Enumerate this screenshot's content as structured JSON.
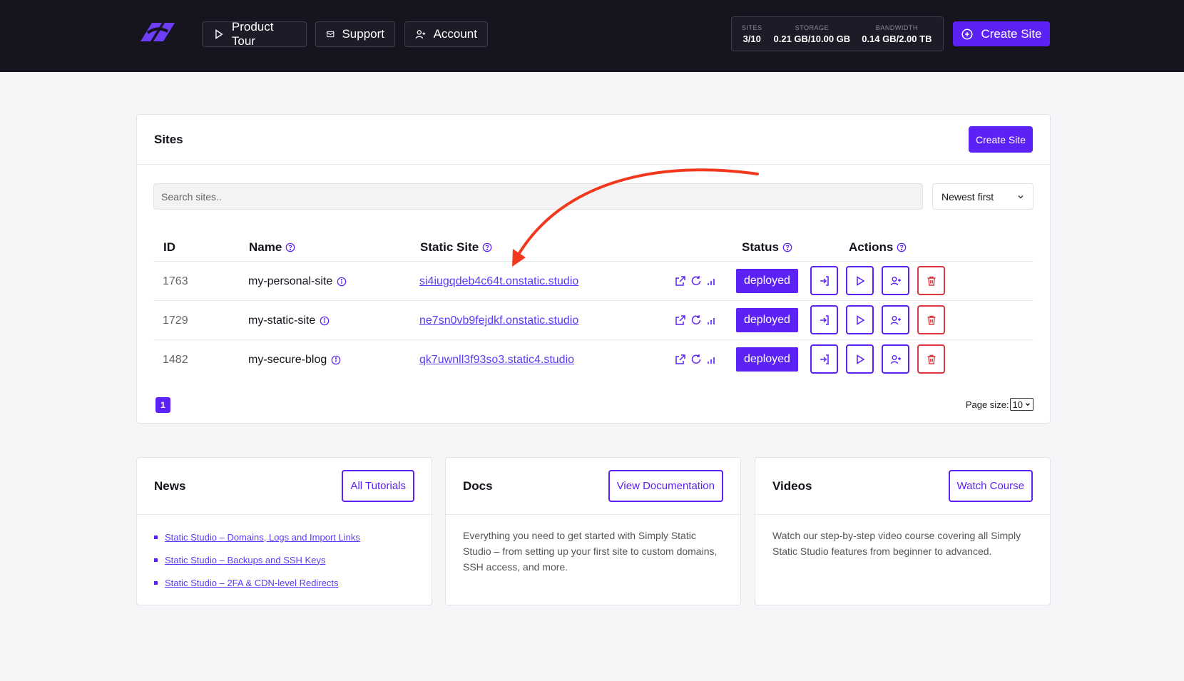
{
  "header": {
    "nav": [
      {
        "label": "Product Tour",
        "icon": "play-icon"
      },
      {
        "label": "Support",
        "icon": "mail-icon"
      },
      {
        "label": "Account",
        "icon": "user-plus-icon"
      }
    ],
    "stats": [
      {
        "label": "SITES",
        "value": "3/10"
      },
      {
        "label": "STORAGE",
        "value": "0.21 GB/10.00 GB"
      },
      {
        "label": "BANDWIDTH",
        "value": "0.14 GB/2.00 TB"
      }
    ],
    "create_label": "Create Site"
  },
  "sites": {
    "title": "Sites",
    "create_label": "Create Site",
    "search_placeholder": "Search sites..",
    "sort_value": "Newest first",
    "columns": {
      "id": "ID",
      "name": "Name",
      "static_site": "Static Site",
      "status": "Status",
      "actions": "Actions"
    },
    "rows": [
      {
        "id": "1763",
        "name": "my-personal-site",
        "url": "si4iugqdeb4c64t.onstatic.studio",
        "status": "deployed"
      },
      {
        "id": "1729",
        "name": "my-static-site",
        "url": "ne7sn0vb9fejdkf.onstatic.studio",
        "status": "deployed"
      },
      {
        "id": "1482",
        "name": "my-secure-blog",
        "url": "qk7uwnll3f93so3.static4.studio",
        "status": "deployed"
      }
    ],
    "page": "1",
    "page_size_label": "Page size:",
    "page_size": "10"
  },
  "news": {
    "title": "News",
    "button": "All Tutorials",
    "links": [
      "Static Studio – Domains, Logs and Import Links",
      "Static Studio – Backups and SSH Keys",
      "Static Studio – 2FA & CDN-level Redirects"
    ]
  },
  "docs": {
    "title": "Docs",
    "button": "View Documentation",
    "text": "Everything you need to get started with Simply Static Studio – from setting up your first site to custom domains, SSH access, and more."
  },
  "videos": {
    "title": "Videos",
    "button": "Watch Course",
    "text": "Watch our step-by-step video course covering all Simply Static Studio features from beginner to advanced."
  },
  "colors": {
    "accent": "#5b21f5",
    "topbar": "#15141f",
    "danger": "#d9363e",
    "annotation": "#f2391e"
  }
}
